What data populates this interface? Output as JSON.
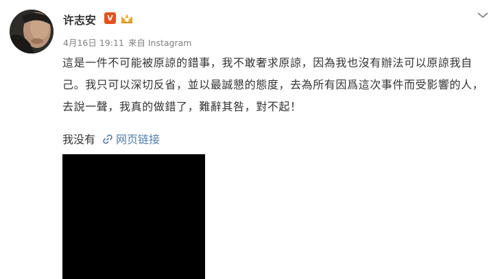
{
  "user": {
    "name": "许志安",
    "verified_mark": "V",
    "verified_color": "#e8501a"
  },
  "meta": {
    "date": "4月16日 19:11",
    "source": "来自 Instagram"
  },
  "post": {
    "text": "這是一件不可能被原諒的錯事，我不敢奢求原諒，因為我也沒有辦法可以原諒我自己。我只可以深切反省，並以最誠懇的態度，去為所有因爲這次事件而受影響的人，去說一聲，我真的做錯了，難辭其咎，對不起！"
  },
  "link": {
    "topic": "我没有",
    "label": "网页链接",
    "color": "#4f7db0"
  },
  "icons": {
    "dropdown": "chevron-down-icon",
    "link": "link-icon",
    "badge": "member-badge-icon"
  }
}
